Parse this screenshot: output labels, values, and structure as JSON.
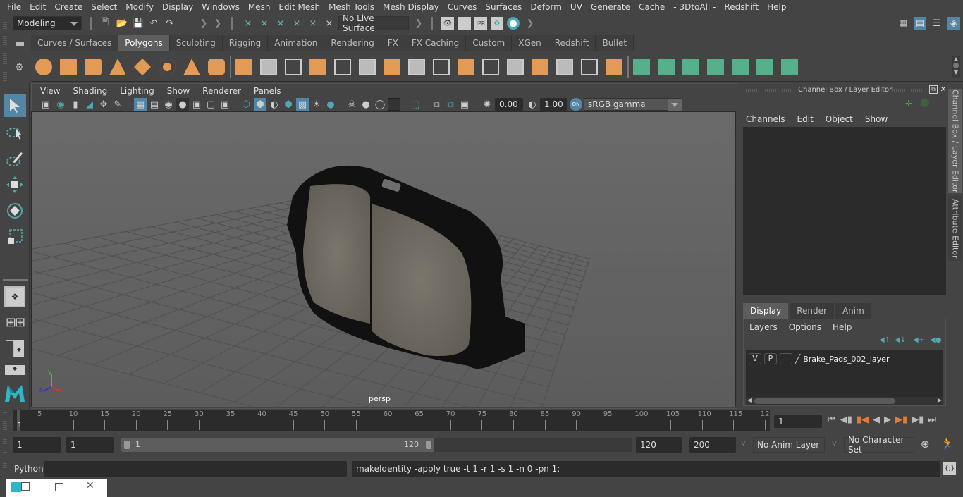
{
  "menubar": {
    "items": [
      "File",
      "Edit",
      "Create",
      "Select",
      "Modify",
      "Display",
      "Windows",
      "Mesh",
      "Edit Mesh",
      "Mesh Tools",
      "Mesh Display",
      "Curves",
      "Surfaces",
      "Deform",
      "UV",
      "Generate",
      "Cache",
      "- 3DtoAll -",
      "Redshift",
      "Help"
    ]
  },
  "statusline": {
    "mode_selector": "Modeling",
    "live_surface": "No Live Surface"
  },
  "shelf": {
    "tabs": [
      "Curves / Surfaces",
      "Polygons",
      "Sculpting",
      "Rigging",
      "Animation",
      "Rendering",
      "FX",
      "FX Caching",
      "Custom",
      "XGen",
      "Redshift",
      "Bullet"
    ],
    "active_tab": "Polygons",
    "orange_icons": [
      "poly-sphere-icon",
      "poly-cube-icon",
      "poly-cylinder-icon",
      "poly-cone-icon",
      "poly-plane-icon",
      "poly-torus-icon",
      "poly-pyramid-icon",
      "poly-pipe-icon"
    ],
    "tool_icons": [
      "combine-icon",
      "separate-icon",
      "mirror-icon",
      "smooth-icon",
      "bevel-icon",
      "extrude-icon",
      "multi-cut-icon",
      "bridge-icon",
      "append-icon",
      "fill-hole-icon",
      "insert-edge-loop-icon",
      "offset-edge-loop-icon",
      "connect-icon",
      "target-weld-icon",
      "quad-draw-icon",
      "circularize-icon"
    ],
    "uv_icons": [
      "planar-uv-icon",
      "cylindrical-uv-icon",
      "spherical-uv-icon",
      "automatic-uv-icon",
      "unfold-uv-icon",
      "uv-editor-icon",
      "uv-layout-icon"
    ]
  },
  "viewport": {
    "menus": [
      "View",
      "Shading",
      "Lighting",
      "Show",
      "Renderer",
      "Panels"
    ],
    "exposure": "0.00",
    "gamma": "1.00",
    "color_space_toggle": "ON",
    "color_space": "sRGB gamma",
    "camera_label": "persp",
    "axis_labels": {
      "x": "x",
      "y": "y",
      "z": "z"
    }
  },
  "channel_box": {
    "title": "Channel Box / Layer Editor",
    "menus": [
      "Channels",
      "Edit",
      "Object",
      "Show"
    ],
    "layer_tabs": [
      "Display",
      "Render",
      "Anim"
    ],
    "active_layer_tab": "Display",
    "layer_menus": [
      "Layers",
      "Options",
      "Help"
    ],
    "layers": [
      {
        "visible": "V",
        "playback": "P",
        "name": "Brake_Pads_002_layer"
      }
    ]
  },
  "side_tabs": [
    "Channel Box / Layer Editor",
    "Attribute Editor"
  ],
  "timeline": {
    "ticks": [
      "5",
      "10",
      "15",
      "20",
      "25",
      "30",
      "35",
      "40",
      "45",
      "50",
      "55",
      "60",
      "65",
      "70",
      "75",
      "80",
      "85",
      "90",
      "95",
      "100",
      "105",
      "110",
      "115",
      "12"
    ],
    "current_frame_marker": "1",
    "current_frame": "1"
  },
  "range": {
    "start_time": "1",
    "playback_start": "1",
    "slider_start": "1",
    "slider_end": "120",
    "playback_end": "120",
    "end_time": "200",
    "anim_layer": "No Anim Layer",
    "character_set": "No Character Set"
  },
  "cmdline": {
    "language": "Python",
    "input": "",
    "result": "makeIdentity -apply true -t 1 -r 1 -s 1 -n 0 -pn 1;"
  },
  "colors": {
    "accent_blue": "#5285a6",
    "shelf_orange": "#e29a55",
    "shelf_green": "#56b08a",
    "playhead_orange": "#e07b39"
  }
}
